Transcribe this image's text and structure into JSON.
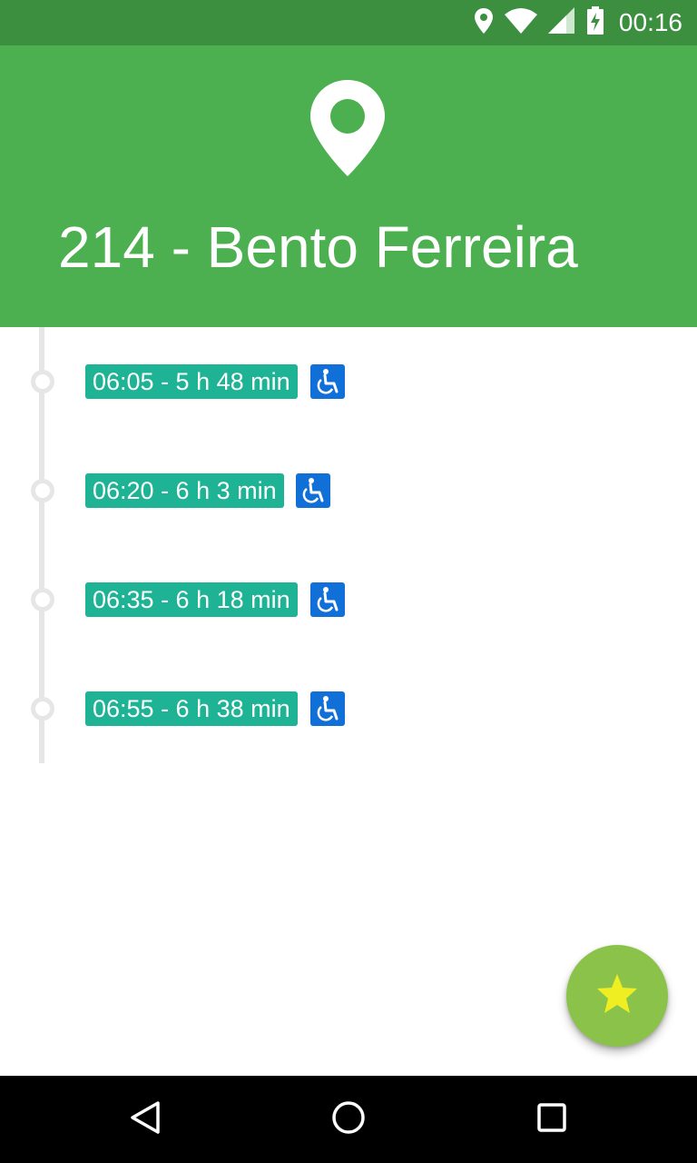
{
  "status_bar": {
    "time": "00:16",
    "icons": [
      "location-icon",
      "wifi-icon",
      "signal-icon",
      "battery-charging-icon"
    ]
  },
  "header": {
    "icon": "map-pin-icon",
    "title": "214 - Bento Ferreira"
  },
  "departures": [
    {
      "label": "06:05 - 5 h 48 min",
      "accessible": true
    },
    {
      "label": "06:20 - 6 h 3 min",
      "accessible": true
    },
    {
      "label": "06:35 - 6 h 18 min",
      "accessible": true
    },
    {
      "label": "06:55 - 6 h 38 min",
      "accessible": true
    }
  ],
  "fab": {
    "icon": "star-icon"
  },
  "nav_bar": {
    "icons": [
      "back-icon",
      "home-icon",
      "recents-icon"
    ]
  },
  "colors": {
    "status_bar": "#3b8f3f",
    "header": "#4caf50",
    "badge": "#1db394",
    "accessible": "#1070d8",
    "fab": "#8bc34a",
    "star": "#eeee22"
  }
}
